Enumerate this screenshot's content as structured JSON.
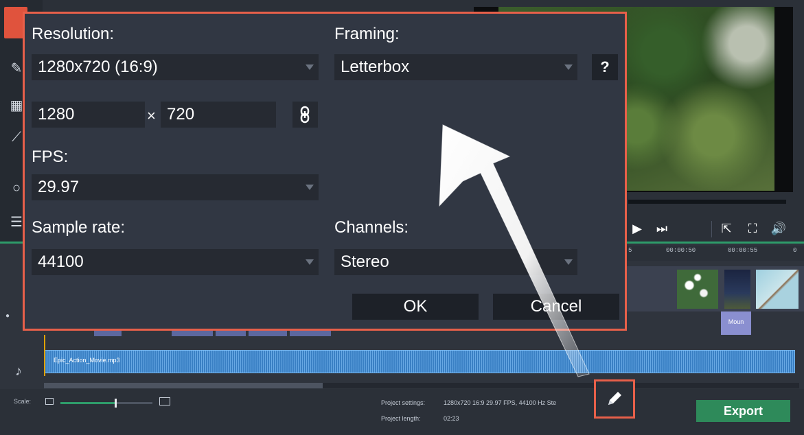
{
  "dialog": {
    "resolution_label": "Resolution:",
    "resolution_value": "1280x720 (16:9)",
    "width_value": "1280",
    "times_symbol": "×",
    "height_value": "720",
    "fps_label": "FPS:",
    "fps_value": "29.97",
    "sample_rate_label": "Sample rate:",
    "sample_rate_value": "44100",
    "framing_label": "Framing:",
    "framing_value": "Letterbox",
    "help_label": "?",
    "channels_label": "Channels:",
    "channels_value": "Stereo",
    "ok_label": "OK",
    "cancel_label": "Cancel"
  },
  "timeline": {
    "ruler_ticks": [
      "5",
      "00:00:50",
      "00:00:55",
      "0"
    ],
    "audio_clip": "Epic_Action_Movie.mp3",
    "sub_clip": "Moun"
  },
  "bottom": {
    "scale_label": "Scale:",
    "project_settings_label": "Project settings:",
    "project_settings_value": "1280x720 16:9 29.97 FPS, 44100 Hz Ste",
    "project_length_label": "Project length:",
    "project_length_value": "02:23",
    "export_label": "Export",
    "scale_level": 0.6
  },
  "colors": {
    "highlight": "#e8604a",
    "export_green": "#2e8a5a",
    "accent_green": "#2e9c6a",
    "dialog_bg": "#313743"
  }
}
